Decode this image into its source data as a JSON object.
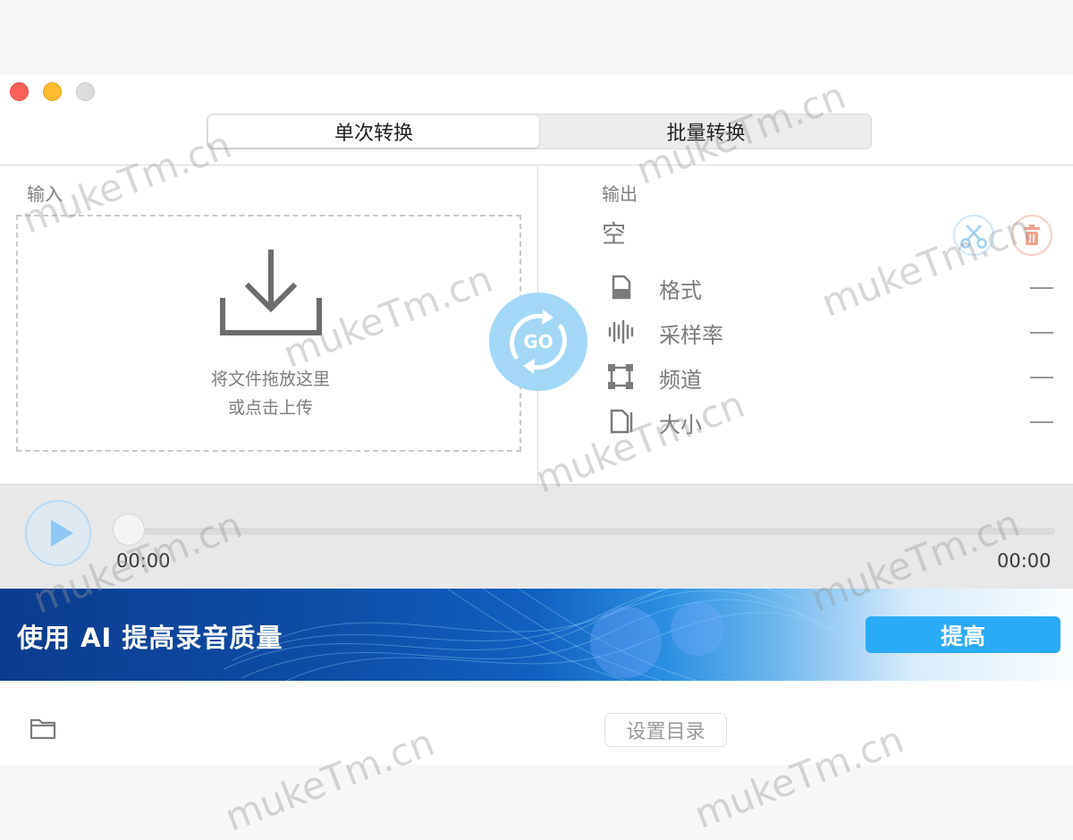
{
  "tabs": {
    "single": "单次转换",
    "batch": "批量转换"
  },
  "input": {
    "label": "输入",
    "drop_line1": "将文件拖放这里",
    "drop_line2": "或点击上传"
  },
  "go": {
    "label": "GO"
  },
  "output": {
    "label": "输出",
    "status": "空",
    "props": [
      {
        "label": "格式",
        "icon": "document-icon",
        "value": "—"
      },
      {
        "label": "采样率",
        "icon": "waveform-icon",
        "value": "—"
      },
      {
        "label": "频道",
        "icon": "channel-frame-icon",
        "value": "—"
      },
      {
        "label": "大小",
        "icon": "file-size-icon",
        "value": "—"
      }
    ]
  },
  "player": {
    "current_time": "00:00",
    "total_time": "00:00"
  },
  "banner": {
    "title": "使用 AI 提高录音质量",
    "button": "提高"
  },
  "footer": {
    "set_dir": "设置目录"
  },
  "watermark": "mukeTm.cn",
  "colors": {
    "accent": "#2baaf6",
    "go": "#a3d7f6",
    "delete": "#f3a48f",
    "close": "#fe5f57",
    "minimize": "#febc2e"
  }
}
